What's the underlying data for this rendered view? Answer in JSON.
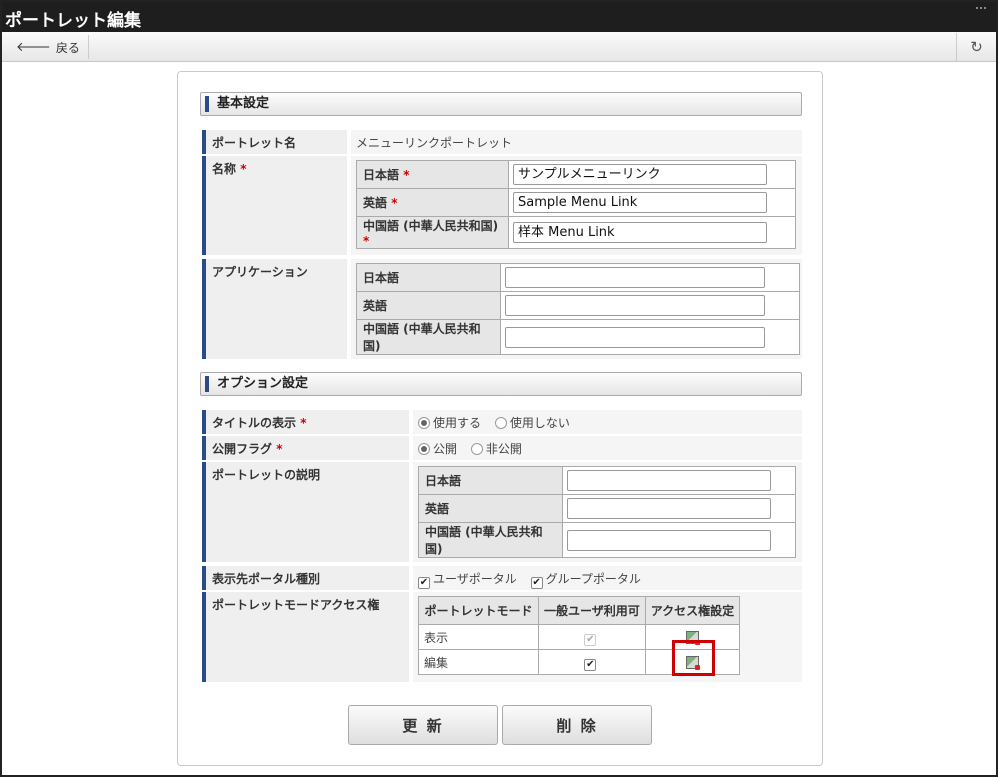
{
  "window": {
    "title": "ポートレット編集"
  },
  "toolbar": {
    "back_label": "戻る"
  },
  "basic": {
    "section_title": "基本設定",
    "portlet_name_label": "ポートレット名",
    "portlet_name_value": "メニューリンクポートレット",
    "name_label": "名称",
    "name_rows": [
      {
        "lang": "日本語",
        "required": "*",
        "value": "サンプルメニューリンク"
      },
      {
        "lang": "英語",
        "required": "*",
        "value": "Sample Menu Link"
      },
      {
        "lang": "中国語 (中華人民共和国)",
        "required": "*",
        "value": "样本 Menu Link"
      }
    ],
    "app_label": "アプリケーション",
    "app_rows": [
      {
        "lang": "日本語",
        "value": ""
      },
      {
        "lang": "英語",
        "value": ""
      },
      {
        "lang": "中国語 (中華人民共和国)",
        "value": ""
      }
    ]
  },
  "options": {
    "section_title": "オプション設定",
    "title_display_label": "タイトルの表示",
    "title_display_options": [
      "使用する",
      "使用しない"
    ],
    "title_display_selected": "使用する",
    "public_flag_label": "公開フラグ",
    "public_flag_options": [
      "公開",
      "非公開"
    ],
    "public_flag_selected": "公開",
    "description_label": "ポートレットの説明",
    "description_rows": [
      {
        "lang": "日本語",
        "value": ""
      },
      {
        "lang": "英語",
        "value": ""
      },
      {
        "lang": "中国語 (中華人民共和国)",
        "value": ""
      }
    ],
    "portal_type_label": "表示先ポータル種別",
    "portal_types": [
      {
        "label": "ユーザポータル",
        "checked": true
      },
      {
        "label": "グループポータル",
        "checked": true
      }
    ],
    "mode_access_label": "ポートレットモードアクセス権",
    "mode_table": {
      "headers": [
        "ポートレットモード",
        "一般ユーザ利用可",
        "アクセス権設定"
      ],
      "rows": [
        {
          "mode": "表示",
          "user_available": true,
          "disabled": true,
          "access_icon": "access-settings-icon"
        },
        {
          "mode": "編集",
          "user_available": true,
          "disabled": false,
          "access_icon": "access-settings-icon"
        }
      ]
    }
  },
  "actions": {
    "update_label": "更 新",
    "delete_label": "削 除"
  },
  "required_mark": "*",
  "colors": {
    "title_bar": "#1e1e1e",
    "section_accent": "#2b4a8a",
    "required": "#cc0000",
    "highlight": "#d00000"
  }
}
